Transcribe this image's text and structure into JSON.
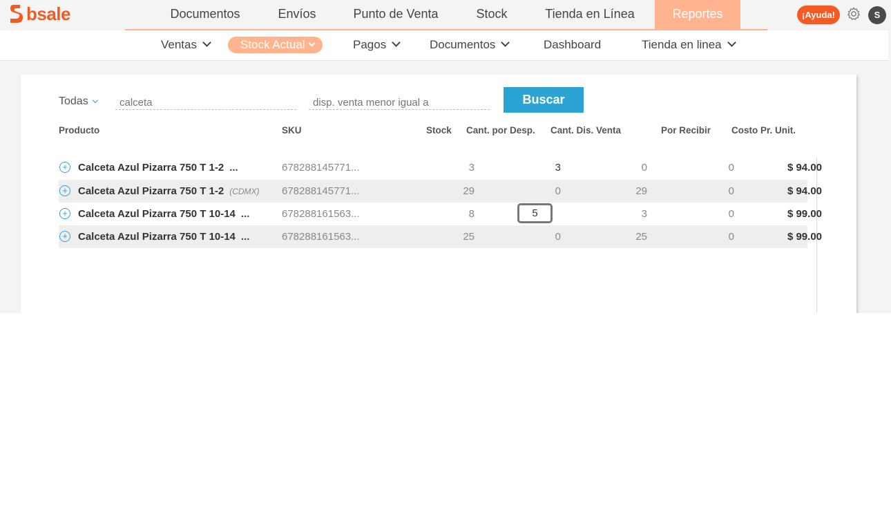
{
  "brand": {
    "name": "bsale",
    "color": "#f45b24"
  },
  "main_nav": {
    "items": [
      {
        "label": "Documentos"
      },
      {
        "label": "Envíos"
      },
      {
        "label": "Punto de Venta"
      },
      {
        "label": "Stock"
      },
      {
        "label": "Tienda en Línea"
      },
      {
        "label": "Reportes"
      }
    ],
    "active_index": 5,
    "active_color": "#ffb48f"
  },
  "header_actions": {
    "help_label": "¡Ayuda!",
    "settings_icon": "gear-icon",
    "avatar_initial": "S"
  },
  "sub_nav": {
    "items": [
      {
        "label": "Ventas"
      },
      {
        "label": "Stock Actual"
      },
      {
        "label": "Pagos"
      },
      {
        "label": "Documentos"
      },
      {
        "label": "Dashboard"
      },
      {
        "label": "Tienda en linea"
      }
    ],
    "active_index": 1
  },
  "filters": {
    "category": "Todas",
    "search_value": "calceta",
    "stock_placeholder": "disp. venta menor igual a",
    "search_button": "Buscar",
    "accent_color": "#2ba4d4"
  },
  "table": {
    "headers": [
      "Producto",
      "SKU",
      "Stock",
      "Cant. por Desp.",
      "Cant. Dis. Venta",
      "Por Recibir",
      "Costo Pr. Unit."
    ],
    "rows": [
      {
        "product": "Calceta Azul Pizarra 750 T 1-2",
        "suffix": "...",
        "store": "",
        "sku": "678288145771...",
        "stock": "3",
        "desp": "3",
        "venta": "0",
        "recibir": "0",
        "costo": "$ 94.00"
      },
      {
        "product": "Calceta Azul Pizarra 750 T 1-2",
        "suffix": "",
        "store": "(CDMX)",
        "sku": "678288145771...",
        "stock": "29",
        "desp": "0",
        "venta": "29",
        "recibir": "0",
        "costo": "$ 94.00"
      },
      {
        "product": "Calceta Azul Pizarra 750 T 10-14",
        "suffix": "...",
        "store": "",
        "sku": "678288161563...",
        "stock": "8",
        "desp": "5",
        "venta": "3",
        "recibir": "0",
        "costo": "$ 99.00"
      },
      {
        "product": "Calceta Azul Pizarra 750 T 10-14",
        "suffix": "...",
        "store": "",
        "sku": "678288161563...",
        "stock": "25",
        "desp": "0",
        "venta": "25",
        "recibir": "0",
        "costo": "$ 99.00"
      }
    ]
  }
}
